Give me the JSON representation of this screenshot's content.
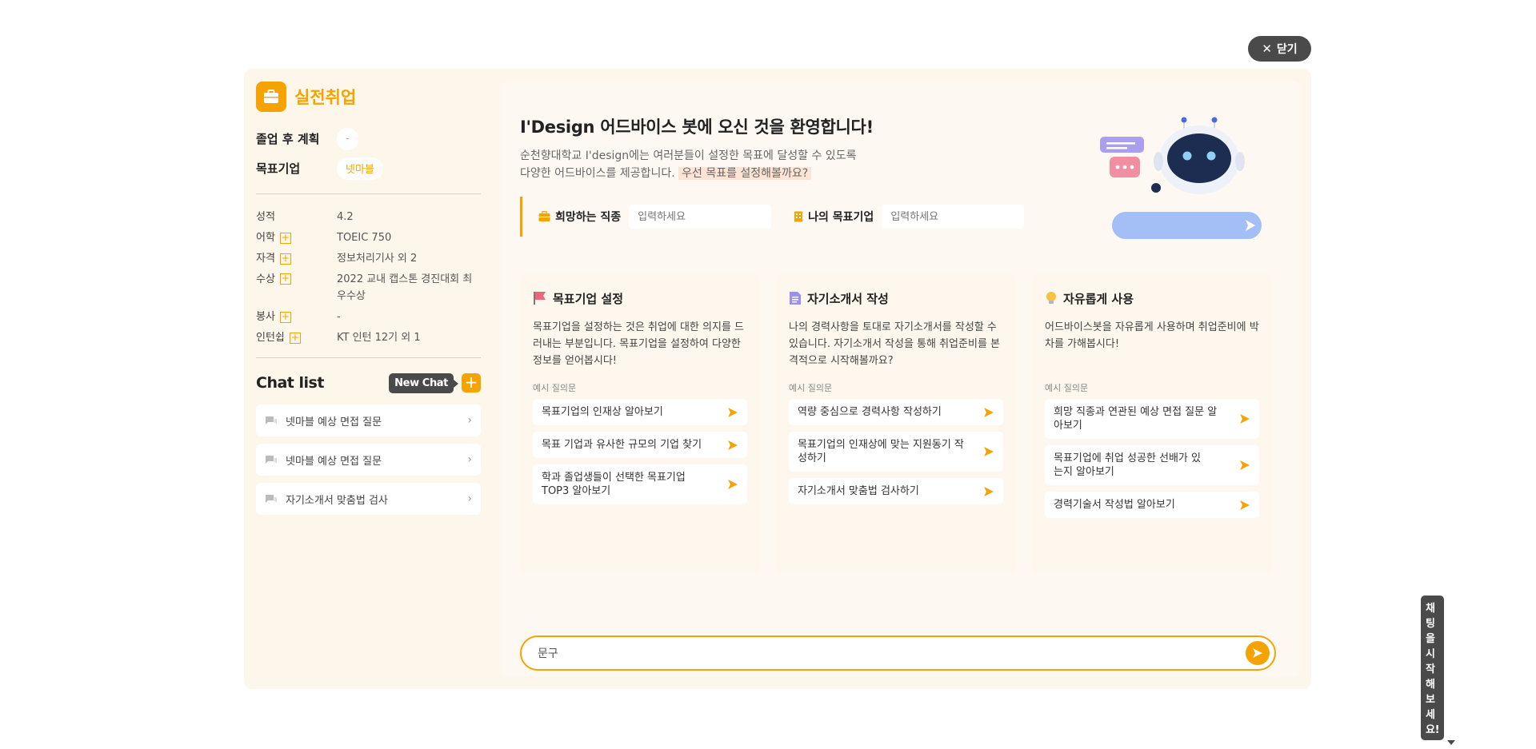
{
  "close_button": {
    "label": "닫기",
    "icon": "close-icon"
  },
  "sidebar": {
    "brand": {
      "title": "실전취업",
      "icon": "briefcase-icon"
    },
    "plans": [
      {
        "label": "졸업 후 계획",
        "value": "-"
      },
      {
        "label": "목표기업",
        "value": "넷마블"
      }
    ],
    "specs": [
      {
        "label": "성적",
        "value": "4.2",
        "addable": false
      },
      {
        "label": "어학",
        "value": "TOEIC 750",
        "addable": true
      },
      {
        "label": "자격",
        "value": "정보처리기사 외 2",
        "addable": true
      },
      {
        "label": "수상",
        "value": "2022 교내 캡스톤 경진대회 최우수상",
        "addable": true
      },
      {
        "label": "봉사",
        "value": "-",
        "addable": true
      },
      {
        "label": "인턴쉽",
        "value": "KT 인턴 12기 외 1",
        "addable": true
      }
    ],
    "chat_list": {
      "title": "Chat list",
      "new_chat_tooltip": "New Chat",
      "items": [
        {
          "label": "넷마블 예상 면접 질문"
        },
        {
          "label": "넷마블 예상 면접 질문"
        },
        {
          "label": "자기소개서 맞춤법 검사"
        }
      ]
    }
  },
  "main": {
    "welcome": "I'Design 어드바이스 봇에 오신 것을 환영합니다!",
    "desc_line1": "순천향대학교 I'design에는 여러분들이 설정한 목표에 달성할 수 있도록",
    "desc_line2": "다양한 어드바이스를 제공합니다.",
    "desc_highlight": "우선 목표를 설정해볼까요?",
    "goal_bar": {
      "job_label": "희망하는 직종",
      "job_placeholder": "입력하세요",
      "company_label": "나의 목표기업",
      "company_placeholder": "입력하세요"
    },
    "cards": [
      {
        "icon": "flag-icon",
        "title": "목표기업 설정",
        "desc": "목표기업을 설정하는 것은 취업에 대한 의지를 드러내는 부분입니다. 목표기업을 설정하여 다양한 정보를 얻어봅시다!",
        "example_label": "예시 질의문",
        "questions": [
          "목표기업의 인재상 알아보기",
          "목표 기업과 유사한 규모의 기업 찾기",
          "학과 졸업생들이 선택한 목표기업 TOP3 알아보기"
        ]
      },
      {
        "icon": "document-icon",
        "title": "자기소개서 작성",
        "desc": "나의 경력사항을 토대로 자기소개서를 작성할 수 있습니다. 자기소개서 작성을 통해 취업준비를 본격적으로 시작해볼까요?",
        "example_label": "예시 질의문",
        "questions": [
          "역량 중심으로 경력사항 작성하기",
          "목표기업의 인재상에 맞는 지원동기 작성하기",
          "자기소개서 맞춤법 검사하기"
        ]
      },
      {
        "icon": "lightbulb-icon",
        "title": "자유롭게 사용",
        "desc": "어드바이스봇을 자유롭게 사용하며 취업준비에 박차를 가해봅시다!",
        "example_label": "예시 질의문",
        "questions": [
          "희망 직종과 연관된 예상 면접 질문 알아보기",
          "목표기업에 취업 성공한 선배가 있는지 알아보기",
          "경력기술서 작성법 알아보기"
        ]
      }
    ],
    "start_tooltip": "채팅을 시작해보세요!",
    "chat_input_value": "문구"
  },
  "colors": {
    "accent": "#f5a300",
    "modal_bg": "#fdf6ea",
    "tooltip_bg": "#4a4a4a"
  }
}
